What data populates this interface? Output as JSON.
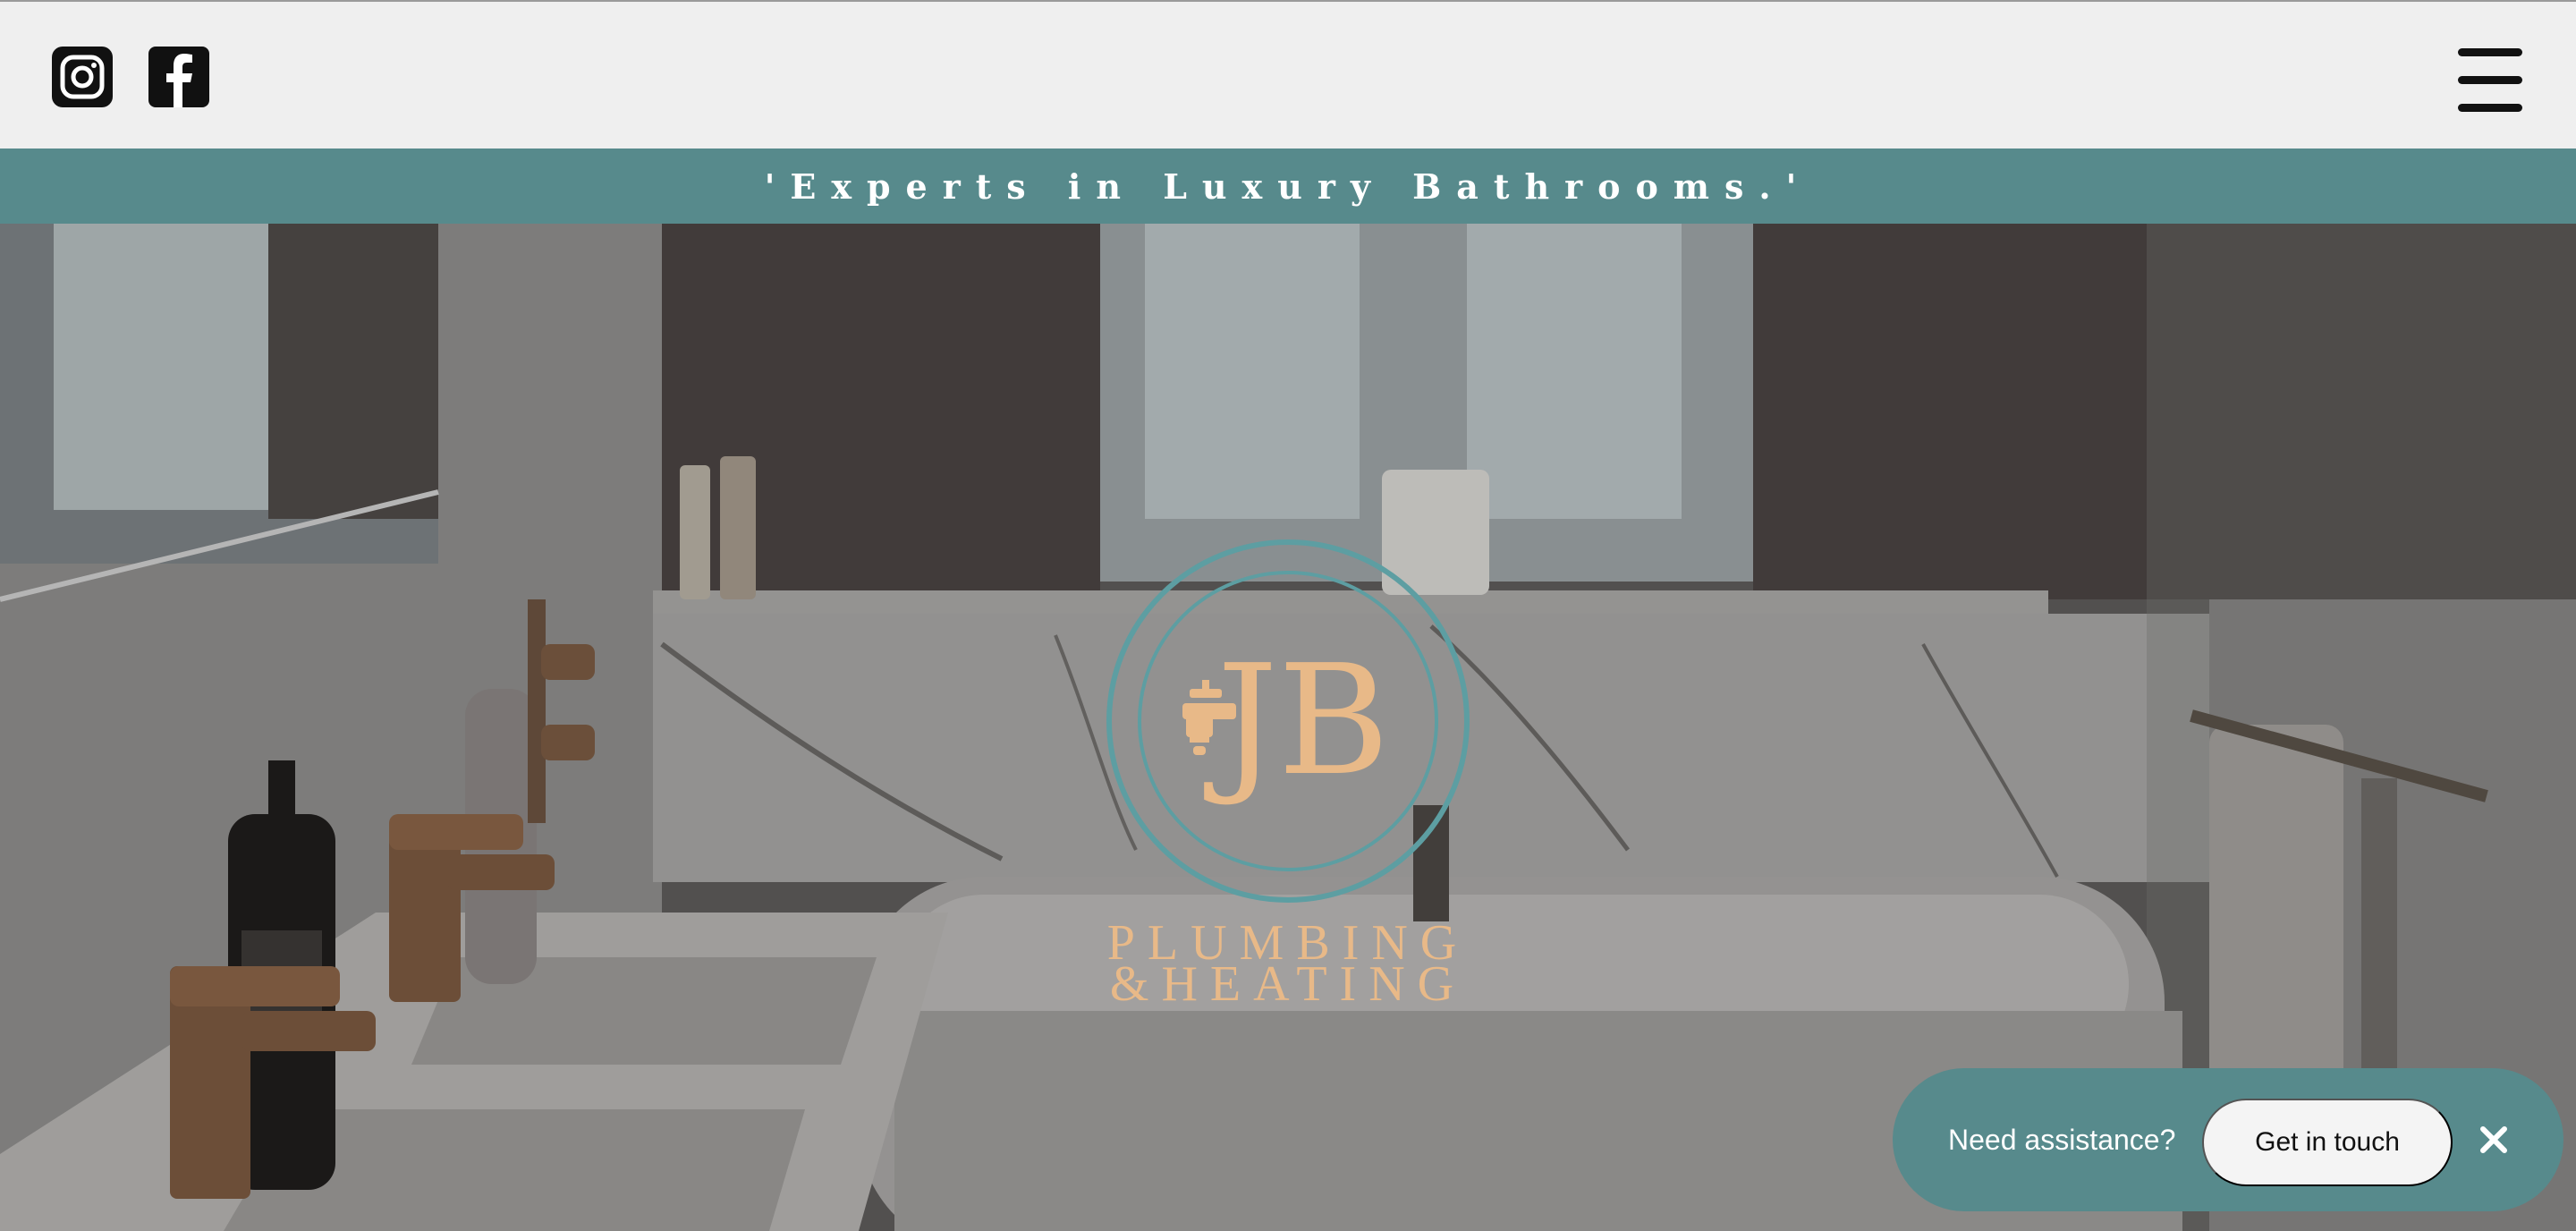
{
  "header": {
    "social": [
      {
        "icon": "instagram-icon"
      },
      {
        "icon": "facebook-icon"
      }
    ],
    "menu_icon": "hamburger-menu-icon"
  },
  "tagline": "'Experts in Luxury Bathrooms.'",
  "logo": {
    "initials": "JB",
    "line1": "PLUMBING",
    "line2": "&HEATING"
  },
  "chat": {
    "prompt": "Need assistance?",
    "cta_label": "Get in touch",
    "close_icon": "close-icon"
  },
  "colors": {
    "accent_teal": "#578a8c",
    "logo_gold": "#e8b988",
    "header_bg": "#efefef"
  }
}
